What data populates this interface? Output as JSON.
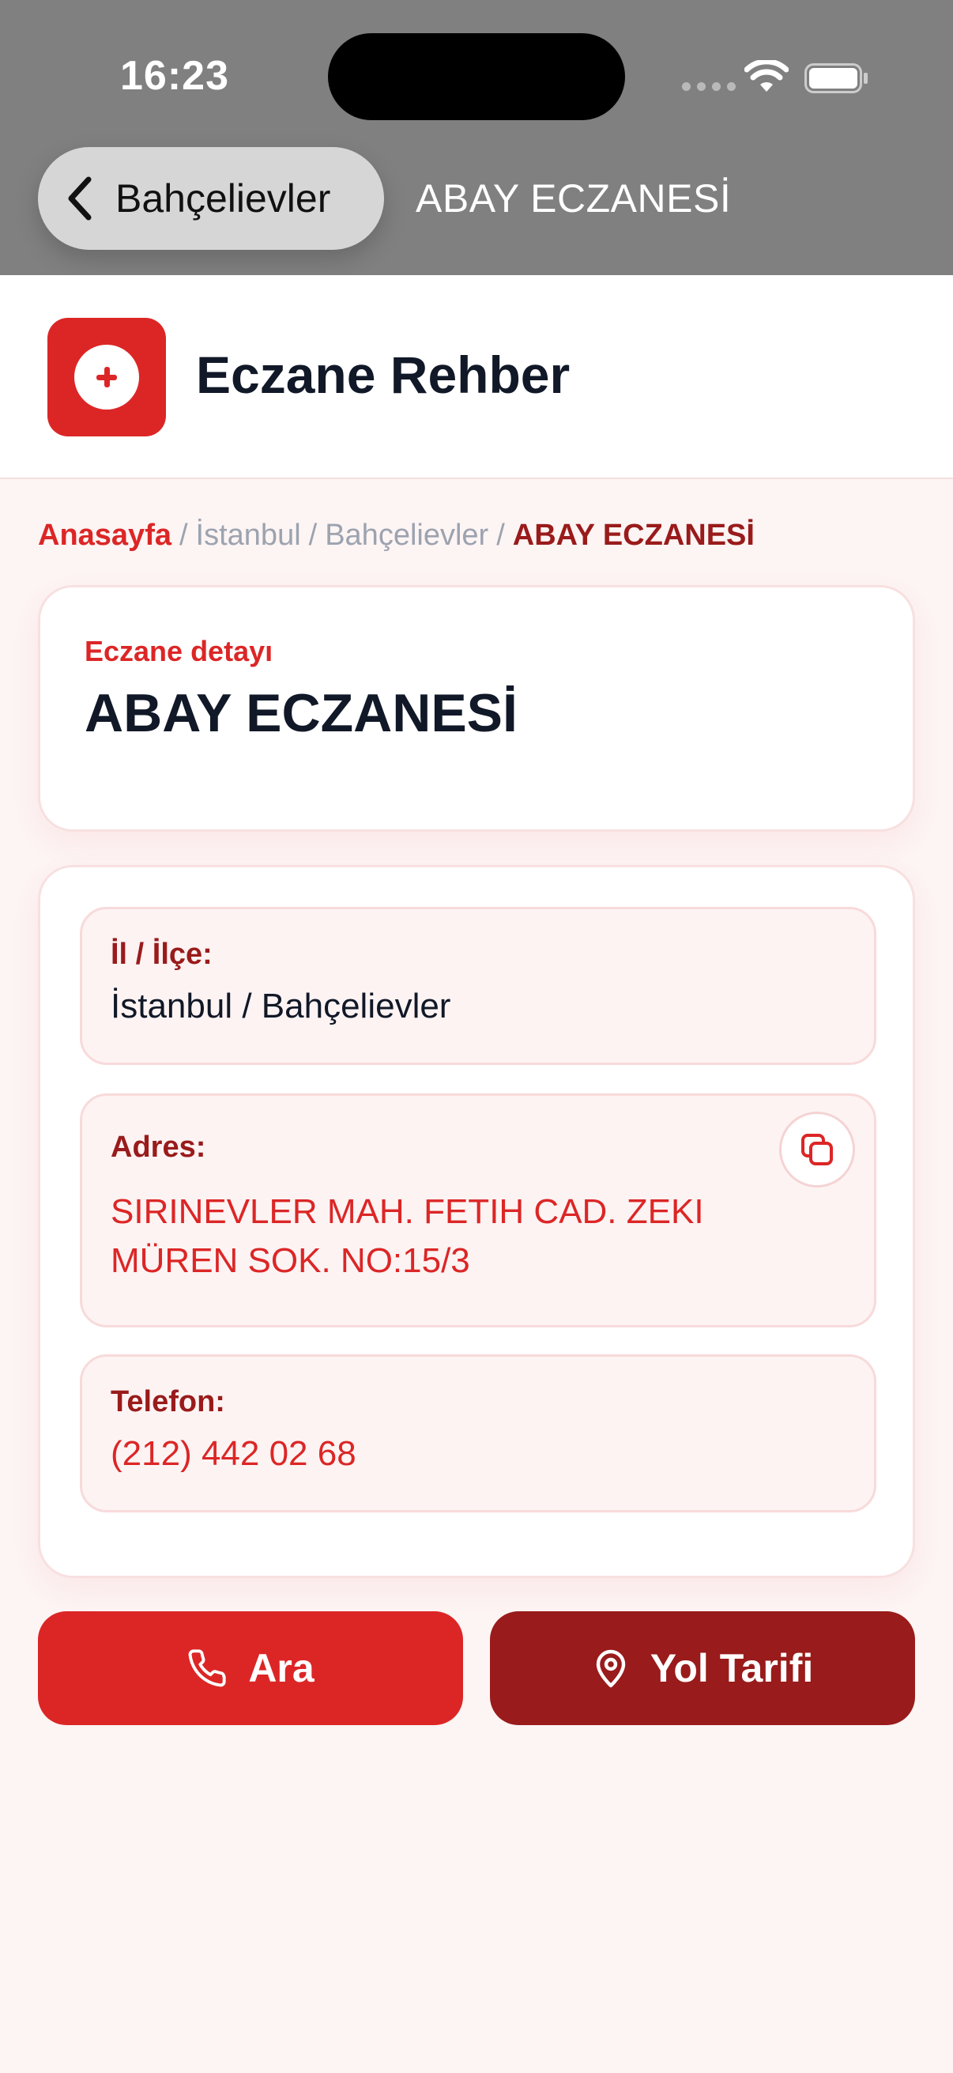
{
  "status_bar": {
    "time": "16:23"
  },
  "nav": {
    "back_label": "Bahçelievler",
    "title": "ABAY ECZANESİ"
  },
  "app": {
    "name": "Eczane Rehber",
    "accent_color": "#dc2626",
    "dark_accent_color": "#991b1b",
    "logo_icon": "plus-circle-icon"
  },
  "breadcrumb": {
    "home": "Anasayfa",
    "separator": "/",
    "city": "İstanbul",
    "district": "Bahçelievler",
    "current": "ABAY ECZANESİ"
  },
  "detail": {
    "eyebrow": "Eczane detayı",
    "name": "ABAY ECZANESİ"
  },
  "info": {
    "city_label": "İl / İlçe:",
    "city_value": "İstanbul / Bahçelievler",
    "address_label": "Adres:",
    "address_value": "SIRINEVLER MAH. FETIH CAD. ZEKI MÜREN SOK. NO:15/3",
    "copy_icon": "copy-icon",
    "phone_label": "Telefon:",
    "phone_value": "(212) 442 02 68"
  },
  "actions": {
    "call_label": "Ara",
    "call_icon": "phone-icon",
    "directions_label": "Yol Tarifi",
    "directions_icon": "map-pin-icon"
  }
}
